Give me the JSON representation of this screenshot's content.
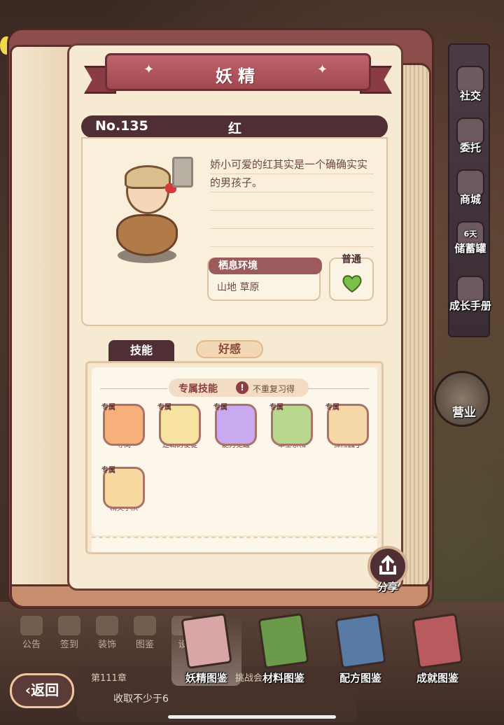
{
  "book": {
    "title": "妖精",
    "entry_number": "No.135",
    "fairy_name": "红",
    "description": "娇小可爱的红其实是一个确确实实的男孩子。",
    "habitat_title": "栖息环境",
    "habitat_value": "山地 草原",
    "rarity": "普通"
  },
  "tabs": [
    {
      "label": "技能",
      "active": true
    },
    {
      "label": "好感",
      "active": false
    }
  ],
  "skills_section": {
    "title": "专属技能",
    "note": "不重复习得",
    "tag": "专属",
    "skills": [
      {
        "name": "导向",
        "color": "#f7b07a"
      },
      {
        "name": "逻辑的使徒",
        "color": "#f6e3a2"
      },
      {
        "name": "能力觉醒",
        "color": "#c9a9f0"
      },
      {
        "name": "草士亲和",
        "color": "#b7d88e"
      },
      {
        "name": "探险园丁",
        "color": "#f6d7a8"
      },
      {
        "name": "精英小队",
        "color": "#f7d9a0"
      }
    ]
  },
  "share": {
    "label": "分享"
  },
  "side_nav": [
    "社交",
    "委托",
    "商城",
    "储蓄罐",
    "成长手册"
  ],
  "side_nav_extra": "6天",
  "shop_label": "营业",
  "bg_menu": [
    "公告",
    "签到",
    "装饰",
    "图鉴",
    "设"
  ],
  "back": {
    "label": "返回"
  },
  "chapter": {
    "label": "第111章",
    "label2": "挑战会",
    "goal": "收取不少于6"
  },
  "book_tabs": [
    {
      "label": "妖精图鉴",
      "color": "#d9a6a8",
      "active": true
    },
    {
      "label": "材料图鉴",
      "color": "#6a9a4a",
      "active": false
    },
    {
      "label": "配方图鉴",
      "color": "#5a7aa6",
      "active": false
    },
    {
      "label": "成就图鉴",
      "color": "#b85a5e",
      "active": false
    }
  ],
  "colors": {
    "accent": "#4f2f33",
    "ribbon": "#b0545c",
    "page": "#f6ead2"
  }
}
